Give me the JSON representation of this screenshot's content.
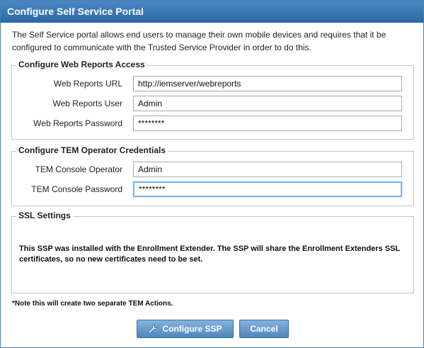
{
  "dialog": {
    "title": "Configure Self Service Portal",
    "intro": "The Self Service portal allows end users to manage their own mobile devices and requires that it be configured to communicate with the Trusted Service Provider in order to do this."
  },
  "web_reports": {
    "legend": "Configure Web Reports Access",
    "url_label": "Web Reports URL",
    "url_value": "http://iemserver/webreports",
    "user_label": "Web Reports User",
    "user_value": "Admin",
    "password_label": "Web Reports Password",
    "password_value": "********"
  },
  "tem_operator": {
    "legend": "Configure TEM Operator Credentials",
    "operator_label": "TEM Console Operator",
    "operator_value": "Admin",
    "password_label": "TEM Console Password",
    "password_value": "********"
  },
  "ssl": {
    "legend": "SSL Settings",
    "message": "This SSP was installed with the Enrollment Extender. The SSP will share the Enrollment Extenders SSL certificates, so no new certificates need to be set."
  },
  "note": "*Note this will create two separate TEM Actions.",
  "buttons": {
    "configure_label": "Configure SSP",
    "configure_icon": "wrench-icon",
    "cancel_label": "Cancel"
  },
  "colors": {
    "titlebar": "#3a7ab8",
    "button": "#5f95c8",
    "focus_border": "#7eb6e8"
  }
}
